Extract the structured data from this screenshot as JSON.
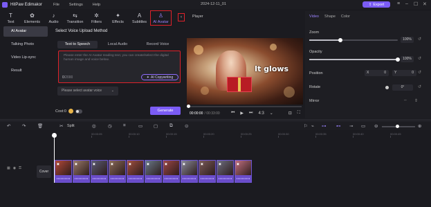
{
  "app": {
    "name": "HitPaw Edimakor",
    "document_title": "2024-12-11_01"
  },
  "menu": [
    "File",
    "Settings",
    "Help"
  ],
  "export_label": "Export",
  "toolbar": [
    {
      "label": "Text",
      "icon": "text-icon",
      "glyph": "T"
    },
    {
      "label": "Elements",
      "icon": "elements-icon",
      "glyph": "✿"
    },
    {
      "label": "Audio",
      "icon": "audio-icon",
      "glyph": "♪"
    },
    {
      "label": "Transition",
      "icon": "transition-icon",
      "glyph": "⇆"
    },
    {
      "label": "Filters",
      "icon": "filters-icon",
      "glyph": "✲"
    },
    {
      "label": "Effects",
      "icon": "effects-icon",
      "glyph": "✦"
    },
    {
      "label": "Subtitles",
      "icon": "subtitles-icon",
      "glyph": "A"
    },
    {
      "label": "AI Avatar",
      "icon": "ai-avatar-icon",
      "glyph": "♙",
      "active": true
    }
  ],
  "sidebar": {
    "items": [
      {
        "label": "AI Avatar",
        "active": true
      },
      {
        "label": "Talking Photo"
      },
      {
        "label": "Video Lip-sync"
      },
      {
        "label": "Result"
      }
    ]
  },
  "panel": {
    "title": "Select Voice Upload Method",
    "tabs": [
      {
        "label": "Text to Speech",
        "active": true
      },
      {
        "label": "Local Audio"
      },
      {
        "label": "Record Voice"
      }
    ],
    "placeholder": "Please enter the AI Avatar reading text, you can create/select the digital human image and voice below.",
    "counter_current": "0",
    "counter_max": "/2000",
    "copywriting_label": "AI Copywriting",
    "voice_placeholder": "Please select avatar voice",
    "cost_label": "Cost:0",
    "generate_label": "Generate"
  },
  "player": {
    "label": "Player",
    "caption": "It glows",
    "current_time": "00:00:00",
    "total_time": "/ 00:33:00",
    "ratio": "4:3",
    "progress": 0
  },
  "properties": {
    "tabs": [
      "Video",
      "Shape",
      "Color"
    ],
    "zoom": {
      "label": "Zoom",
      "value": "100%",
      "level": 0.35
    },
    "opacity": {
      "label": "Opacity",
      "value": "100%",
      "level": 1.0
    },
    "position": {
      "label": "Position",
      "x_label": "X",
      "x": "0",
      "y_label": "Y",
      "y": "0"
    },
    "rotate": {
      "label": "Rotate",
      "value": "0°"
    },
    "mirror": {
      "label": "Mirror"
    }
  },
  "timeline": {
    "split_label": "Split",
    "ruler": [
      "0",
      "00:00:05",
      "00:00:10",
      "00:00:15",
      "00:00:20",
      "00:00:25",
      "00:00:30",
      "00:00:35",
      "00:00:40",
      "00:00:45"
    ],
    "cover_label": "Cover",
    "clip_count": 11,
    "clip_colors": [
      "#b24a3a",
      "#9a7a6a",
      "#5c5c74",
      "#8a6a5a",
      "#a05040",
      "#6a7a8a",
      "#9b4848",
      "#8a8a9a",
      "#7a5a5a",
      "#6e6e80",
      "#c07080"
    ]
  },
  "colors": {
    "accent": "#7b5cf5",
    "highlight": "#e0222a"
  }
}
